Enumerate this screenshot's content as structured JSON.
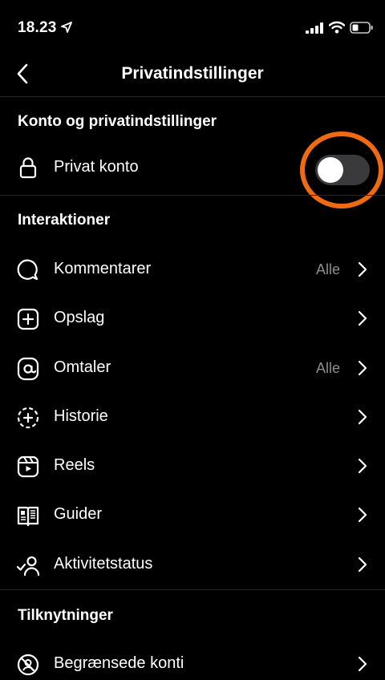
{
  "status_bar": {
    "time": "18.23"
  },
  "header": {
    "title": "Privatindstillinger"
  },
  "account_section": {
    "title": "Konto og privatindstillinger",
    "private_account": {
      "label": "Privat konto",
      "enabled": false
    }
  },
  "interactions": {
    "title": "Interaktioner",
    "items": [
      {
        "label": "Kommentarer",
        "value": "Alle",
        "icon": "comment-icon"
      },
      {
        "label": "Opslag",
        "value": "",
        "icon": "add-post-icon"
      },
      {
        "label": "Omtaler",
        "value": "Alle",
        "icon": "at-icon"
      },
      {
        "label": "Historie",
        "value": "",
        "icon": "story-icon"
      },
      {
        "label": "Reels",
        "value": "",
        "icon": "reels-icon"
      },
      {
        "label": "Guider",
        "value": "",
        "icon": "guide-icon"
      },
      {
        "label": "Aktivitetstatus",
        "value": "",
        "icon": "activity-status-icon"
      }
    ]
  },
  "connections": {
    "title": "Tilknytninger",
    "items": [
      {
        "label": "Begrænsede konti",
        "icon": "restricted-icon"
      }
    ]
  },
  "colors": {
    "background": "#000000",
    "highlight": "#f06a12",
    "toggle_off": "#3a3a3c"
  }
}
